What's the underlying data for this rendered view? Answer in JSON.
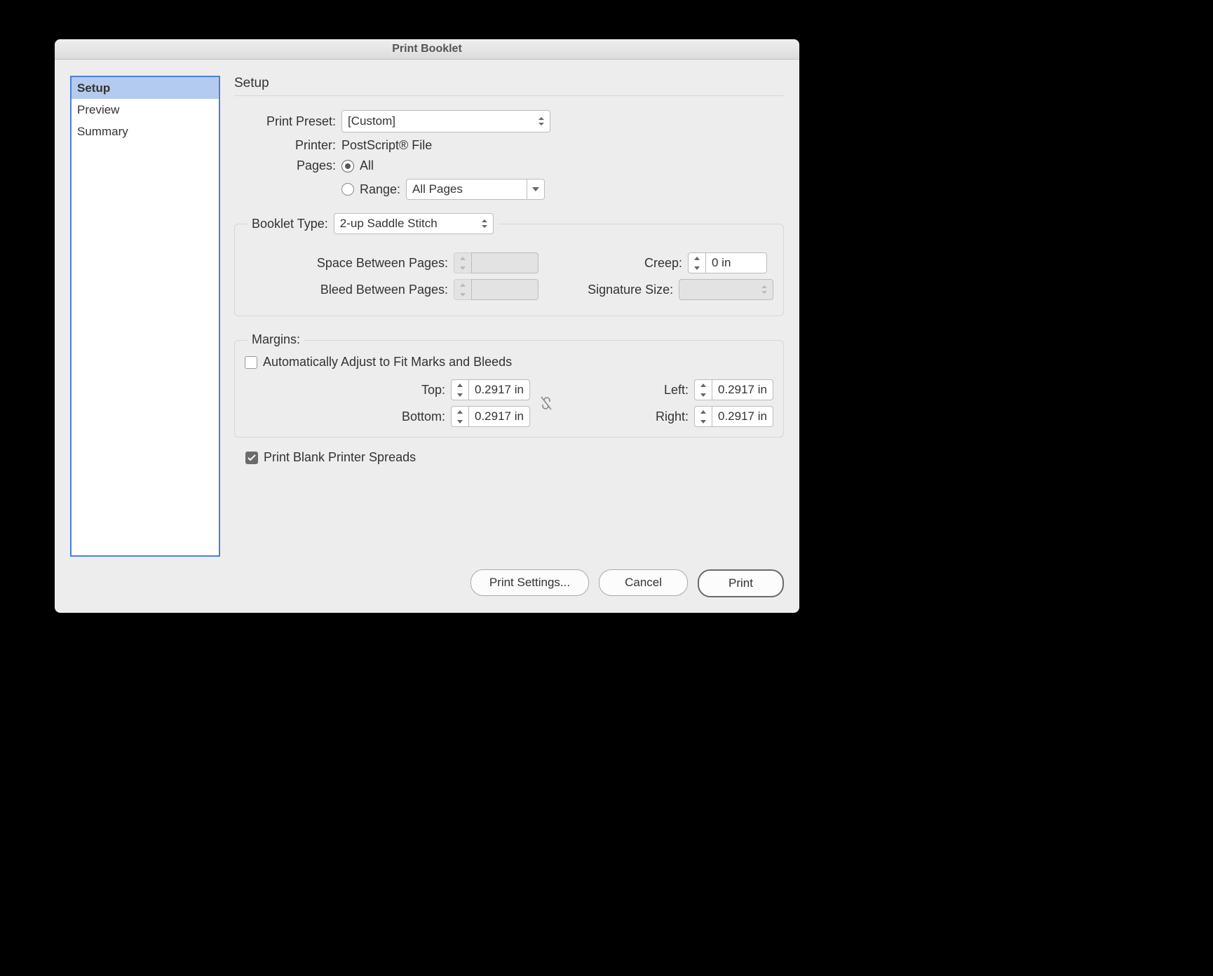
{
  "dialog": {
    "title": "Print Booklet"
  },
  "sidebar": {
    "items": [
      {
        "label": "Setup",
        "selected": true
      },
      {
        "label": "Preview",
        "selected": false
      },
      {
        "label": "Summary",
        "selected": false
      }
    ]
  },
  "panel": {
    "title": "Setup",
    "print_preset": {
      "label": "Print Preset:",
      "value": "[Custom]"
    },
    "printer": {
      "label": "Printer:",
      "value": "PostScript® File"
    },
    "pages": {
      "label": "Pages:",
      "all_label": "All",
      "all_selected": true,
      "range_label": "Range:",
      "range_selected": false,
      "range_value": "All Pages"
    },
    "booklet": {
      "type_label": "Booklet Type:",
      "type_value": "2-up Saddle Stitch",
      "space_label": "Space Between Pages:",
      "space_value": "",
      "bleed_label": "Bleed Between Pages:",
      "bleed_value": "",
      "creep_label": "Creep:",
      "creep_value": "0 in",
      "sig_label": "Signature Size:",
      "sig_value": ""
    },
    "margins": {
      "group_label": "Margins:",
      "auto_label": "Automatically Adjust to Fit Marks and Bleeds",
      "auto_checked": false,
      "top_label": "Top:",
      "top_value": "0.2917 in",
      "bottom_label": "Bottom:",
      "bottom_value": "0.2917 in",
      "left_label": "Left:",
      "left_value": "0.2917 in",
      "right_label": "Right:",
      "right_value": "0.2917 in"
    },
    "blank_spreads": {
      "label": "Print Blank Printer Spreads",
      "checked": true
    }
  },
  "buttons": {
    "print_settings": "Print Settings...",
    "cancel": "Cancel",
    "print": "Print"
  }
}
